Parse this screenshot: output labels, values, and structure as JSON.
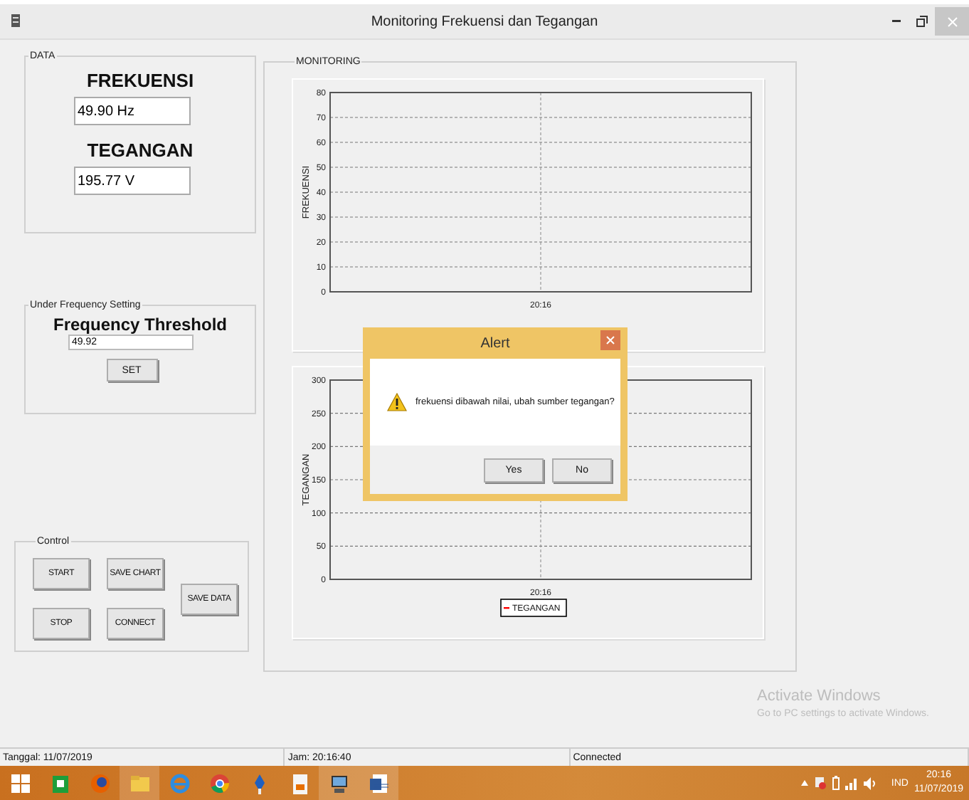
{
  "window": {
    "title": "Monitoring Frekuensi dan Tegangan"
  },
  "data_group": {
    "title": "DATA",
    "frekuensi_label": "FREKUENSI",
    "frekuensi_value": "49.90 Hz",
    "tegangan_label": "TEGANGAN",
    "tegangan_value": "195.77 V"
  },
  "threshold_group": {
    "title": "Under Frequency Setting",
    "heading": "Frequency Threshold",
    "value": "49.92",
    "button": "SET"
  },
  "control_group": {
    "title": "Control",
    "buttons": [
      "START",
      "SAVE CHART",
      "SAVE DATA",
      "STOP",
      "CONNECT"
    ]
  },
  "monitoring": {
    "title": "MONITORING",
    "charts": [
      {
        "y_title": "FREKUENSI",
        "x_labels": [
          "20:16"
        ],
        "y_labels": [
          "80",
          "70",
          "60",
          "50",
          "40",
          "30",
          "20",
          "10",
          "0"
        ]
      },
      {
        "y_title": "TEGANGAN",
        "x_labels": [
          "20:16"
        ],
        "y_labels": [
          "300",
          "250",
          "200",
          "150",
          "100",
          "50",
          "0"
        ],
        "legend": [
          {
            "name": "TEGANGAN",
            "color": "#ff0000"
          }
        ]
      }
    ]
  },
  "alert": {
    "title": "Alert",
    "message": "frekuensi dibawah nilai, ubah sumber tegangan?",
    "buttons": [
      "Yes",
      "No"
    ]
  },
  "activation_notice": {
    "title": "Activate Windows",
    "subtitle": "Go to PC settings to activate Windows."
  },
  "status_bar": [
    "Tanggal: 11/07/2019",
    "Jam: 20:16:40",
    "Connected"
  ],
  "taskbar": {
    "language": "IND",
    "time": "20:16",
    "date": "11/07/2019"
  }
}
